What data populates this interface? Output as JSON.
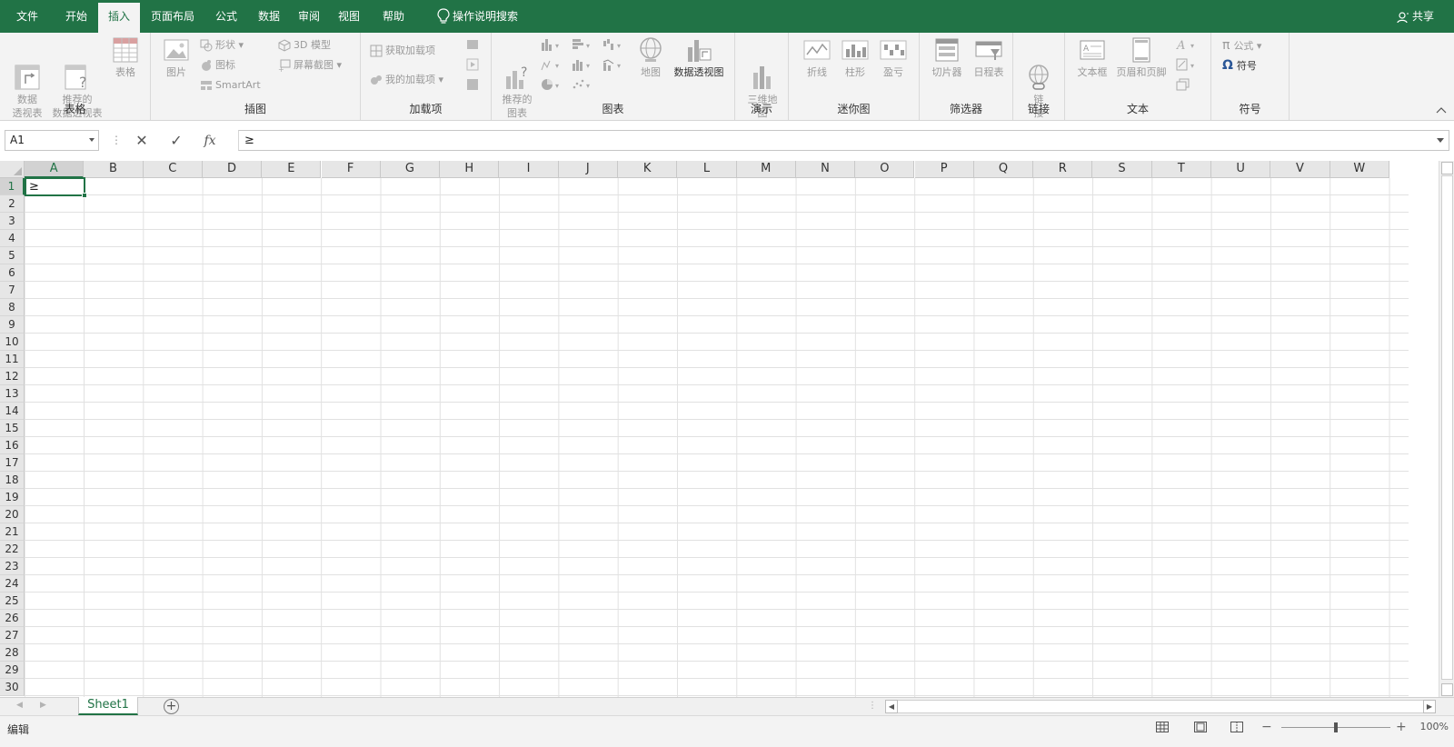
{
  "menu": {
    "tabs": [
      "文件",
      "开始",
      "插入",
      "页面布局",
      "公式",
      "数据",
      "审阅",
      "视图",
      "帮助"
    ],
    "active_tab": "插入",
    "search": "操作说明搜索",
    "share": "共享"
  },
  "ribbon": {
    "groups": {
      "tables": "表格",
      "illustrations": "插图",
      "addins": "加载项",
      "charts": "图表",
      "tours": "演示",
      "sparklines": "迷你图",
      "filters": "筛选器",
      "links": "链接",
      "text": "文本",
      "symbols": "符号"
    },
    "tables": {
      "pivot": "数据\n透视表",
      "rec_pivot": "推荐的\n数据透视表",
      "table": "表格"
    },
    "illustrations": {
      "pictures": "图片",
      "shapes": "形状",
      "icons": "图标",
      "smartart": "SmartArt",
      "model3d": "3D 模型",
      "screenshot": "屏幕截图"
    },
    "addins": {
      "get": "获取加载项",
      "my": "我的加载项"
    },
    "charts": {
      "recommended": "推荐的\n图表",
      "maps": "地图",
      "pivotchart": "数据透视图"
    },
    "tours": {
      "map3d": "三维地\n图"
    },
    "sparklines": {
      "line": "折线",
      "column": "柱形",
      "winloss": "盈亏"
    },
    "filters": {
      "slicer": "切片器",
      "timeline": "日程表"
    },
    "links": {
      "link": "链\n接"
    },
    "text": {
      "textbox": "文本框",
      "headerfooter": "页眉和页脚"
    },
    "symbols": {
      "equation": "公式",
      "symbol": "符号"
    }
  },
  "formula_bar": {
    "name_box": "A1",
    "content": "≥",
    "fx": "fx"
  },
  "grid": {
    "columns": [
      "A",
      "B",
      "C",
      "D",
      "E",
      "F",
      "G",
      "H",
      "I",
      "J",
      "K",
      "L",
      "M",
      "N",
      "O",
      "P",
      "Q",
      "R",
      "S",
      "T",
      "U",
      "V",
      "W"
    ],
    "rows": [
      "1",
      "2",
      "3",
      "4",
      "5",
      "6",
      "7",
      "8",
      "9",
      "10",
      "11",
      "12",
      "13",
      "14",
      "15",
      "16",
      "17",
      "18",
      "19",
      "20",
      "21",
      "22",
      "23",
      "24",
      "25",
      "26",
      "27",
      "28",
      "29",
      "30"
    ],
    "active_cell_value": "≥"
  },
  "sheets": {
    "tabs": [
      "Sheet1"
    ]
  },
  "status": {
    "mode": "编辑",
    "zoom": "100%"
  },
  "colors": {
    "accent": "#217346",
    "ribbon_bg": "#f3f3f3"
  }
}
